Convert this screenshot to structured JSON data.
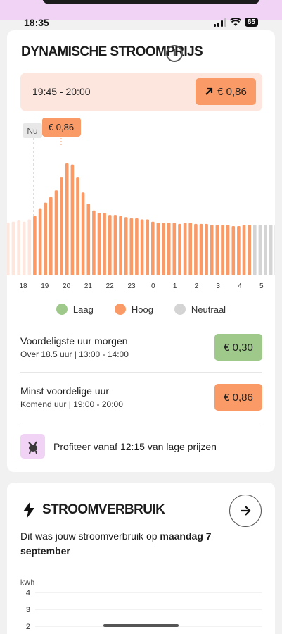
{
  "status_bar": {
    "time": "18:35",
    "battery": "85"
  },
  "price_card": {
    "title": "DYNAMISCHE STROOMPRIJS",
    "selected_slot": {
      "time": "19:45 - 20:00",
      "price": "€ 0,86"
    },
    "now_label": "Nu",
    "tooltip_price": "€ 0,86",
    "legend": [
      {
        "label": "Laag",
        "color": "#9fc98a"
      },
      {
        "label": "Hoog",
        "color": "#fa9a66"
      },
      {
        "label": "Neutraal",
        "color": "#d4d4d4"
      }
    ],
    "cheapest": {
      "title": "Voordeligste uur morgen",
      "subtitle": "Over 18.5 uur | 13:00 - 14:00",
      "price": "€ 0,30"
    },
    "most_expensive": {
      "title": "Minst voordelige uur",
      "subtitle": "Komend uur | 19:00 - 20:00",
      "price": "€ 0,86"
    },
    "promo": "Profiteer vanaf 12:15 van lage prijzen"
  },
  "chart_data": {
    "type": "bar",
    "x_tick_labels": [
      "18",
      "19",
      "20",
      "21",
      "22",
      "23",
      "0",
      "1",
      "2",
      "3",
      "4",
      "5"
    ],
    "values": [
      0.47,
      0.48,
      0.49,
      0.48,
      0.5,
      0.53,
      0.6,
      0.65,
      0.7,
      0.76,
      0.88,
      1.0,
      0.99,
      0.88,
      0.74,
      0.64,
      0.58,
      0.56,
      0.56,
      0.54,
      0.54,
      0.53,
      0.52,
      0.51,
      0.51,
      0.5,
      0.5,
      0.48,
      0.47,
      0.47,
      0.47,
      0.47,
      0.46,
      0.47,
      0.47,
      0.46,
      0.46,
      0.46,
      0.45,
      0.45,
      0.45,
      0.45,
      0.44,
      0.44,
      0.45,
      0.45,
      0.45,
      0.45,
      0.45,
      0.45,
      0.45,
      0.45
    ],
    "colors": [
      "past",
      "past",
      "past",
      "past",
      "past",
      "high",
      "high",
      "high",
      "high",
      "high",
      "high",
      "high",
      "high",
      "high",
      "high",
      "high",
      "high",
      "high",
      "high",
      "high",
      "high",
      "high",
      "high",
      "high",
      "high",
      "high",
      "high",
      "high",
      "high",
      "high",
      "high",
      "high",
      "high",
      "high",
      "high",
      "high",
      "high",
      "high",
      "high",
      "high",
      "high",
      "high",
      "high",
      "high",
      "high",
      "high",
      "neutral",
      "neutral",
      "neutral",
      "neutral",
      "neutral",
      "neutral"
    ],
    "grid": false
  },
  "usage_card": {
    "title": "STROOMVERBRUIK",
    "description_prefix": "Dit was jouw stroomverbruik op",
    "description_bold": "maandag 7 september",
    "chart": {
      "unit": "kWh",
      "y_ticks": [
        "4",
        "3",
        "2"
      ]
    }
  }
}
